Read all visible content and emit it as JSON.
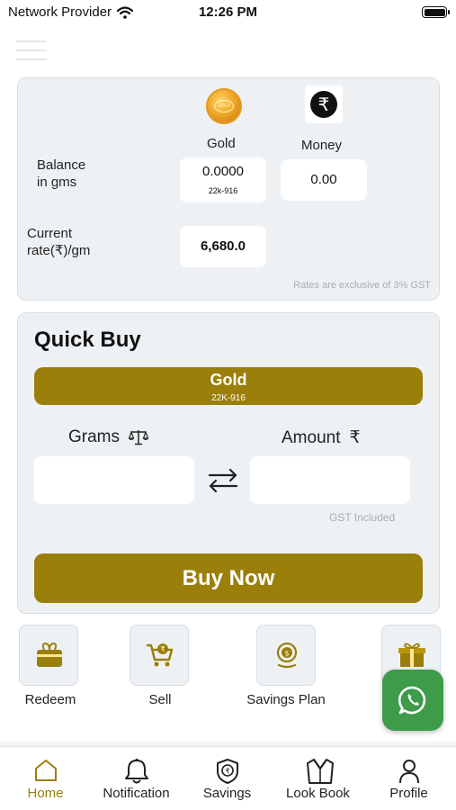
{
  "status_bar": {
    "carrier": "Network Provider",
    "time": "12:26 PM"
  },
  "balance_card": {
    "gold_label": "Gold",
    "money_label": "Money",
    "balance_label_line1": "Balance",
    "balance_label_line2": "in gms",
    "gold_balance": "0.0000",
    "gold_purity": "22k-916",
    "money_balance": "0.00",
    "rate_label_line1": "Current",
    "rate_label_line2": "rate(₹)/gm",
    "current_rate": "6,680.0",
    "gst_note": "Rates are exclusive of 3% GST"
  },
  "quick_buy": {
    "title": "Quick Buy",
    "metal_tab": "Gold",
    "metal_purity": "22K-916",
    "grams_label": "Grams",
    "amount_label": "Amount",
    "rupee_symbol": "₹",
    "grams_value": "",
    "amount_value": "",
    "gst_included": "GST Included",
    "buy_button": "Buy Now"
  },
  "actions": [
    {
      "label": "Redeem",
      "icon": "gift-card-icon"
    },
    {
      "label": "Sell",
      "icon": "cart-icon"
    },
    {
      "label": "Savings Plan",
      "icon": "coin-hand-icon"
    },
    {
      "label": "",
      "icon": "gift-box-icon"
    }
  ],
  "whatsapp_icon": "whatsapp-icon",
  "bottom_nav": [
    {
      "label": "Home",
      "icon": "home-icon",
      "active": true
    },
    {
      "label": "Notification",
      "icon": "bell-icon"
    },
    {
      "label": "Savings",
      "icon": "savings-badge-icon"
    },
    {
      "label": "Look Book",
      "icon": "outfit-icon"
    },
    {
      "label": "Profile",
      "icon": "user-icon"
    }
  ],
  "colors": {
    "accent": "#9b7f0b",
    "card_bg": "#eef1f4",
    "whatsapp": "#3d9b49"
  }
}
